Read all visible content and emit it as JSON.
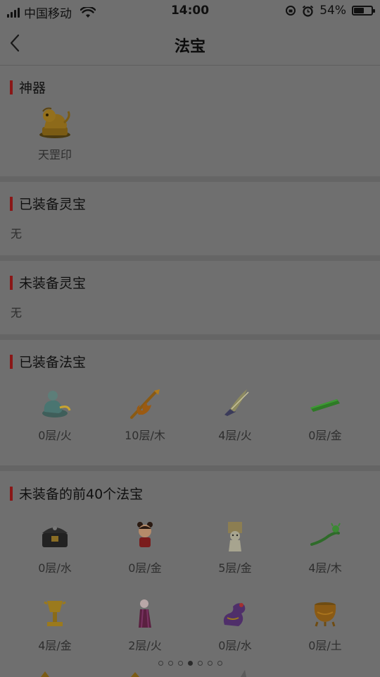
{
  "status_bar": {
    "carrier": "中国移动",
    "time": "14:00",
    "battery": "54%",
    "battery_level": 0.54
  },
  "nav": {
    "title": "法宝",
    "back_icon": "chevron-left-icon"
  },
  "sections": {
    "artifact": {
      "title": "神器",
      "items": [
        {
          "name": "天罡印",
          "icon": "golden-lion-seal-icon"
        }
      ]
    },
    "equipped_lingbao": {
      "title": "已装备灵宝",
      "empty": "无"
    },
    "unequipped_lingbao": {
      "title": "未装备灵宝",
      "empty": "无"
    },
    "equipped_fabao": {
      "title": "已装备法宝",
      "items": [
        {
          "label": "0层/火",
          "icon": "blue-genie-lamp-icon"
        },
        {
          "label": "10层/木",
          "icon": "flaming-sword-icon"
        },
        {
          "label": "4层/火",
          "icon": "feather-quill-icon"
        },
        {
          "label": "0层/金",
          "icon": "green-jade-ruler-icon"
        }
      ]
    },
    "unequipped_fabao": {
      "title": "未装备的前40个法宝",
      "items": [
        {
          "label": "0层/水",
          "icon": "treasure-chest-icon"
        },
        {
          "label": "0层/金",
          "icon": "doll-icon"
        },
        {
          "label": "5层/金",
          "icon": "paper-talisman-icon"
        },
        {
          "label": "4层/木",
          "icon": "green-dragon-whip-icon"
        },
        {
          "label": "4层/金",
          "icon": "golden-cup-icon"
        },
        {
          "label": "2层/火",
          "icon": "purple-skull-staff-icon"
        },
        {
          "label": "0层/水",
          "icon": "purple-dragon-icon"
        },
        {
          "label": "0层/土",
          "icon": "golden-cauldron-icon"
        }
      ]
    }
  },
  "pager": {
    "count": 7,
    "active": 3
  }
}
